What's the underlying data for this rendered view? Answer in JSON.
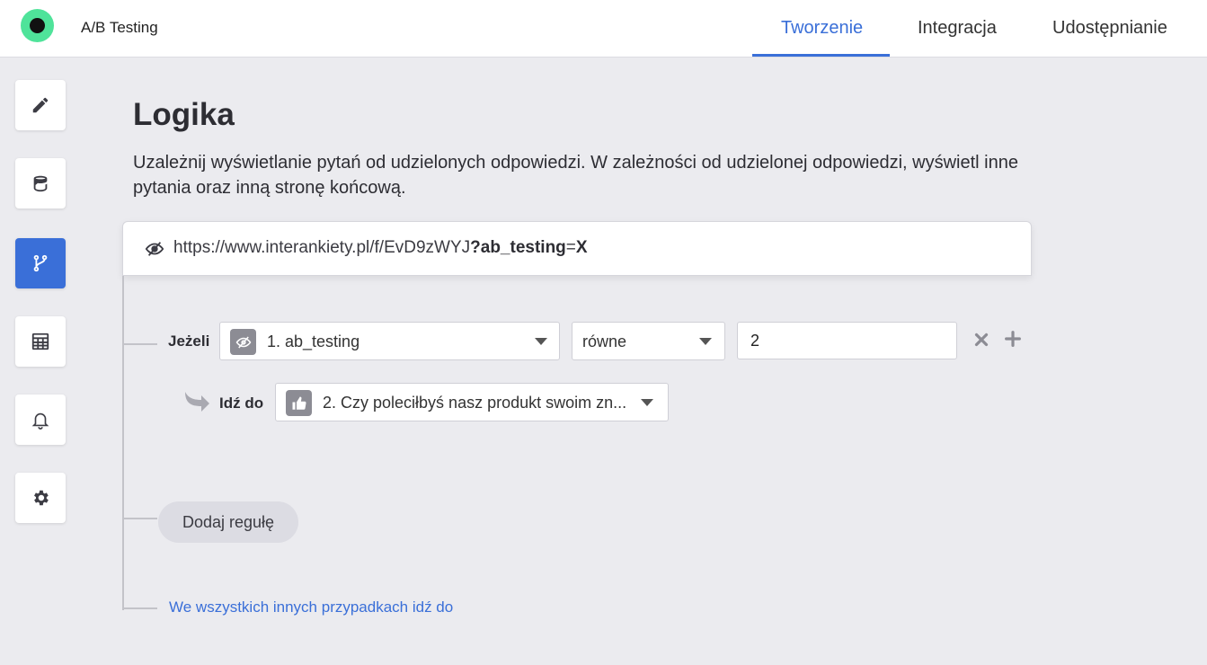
{
  "header": {
    "app_title": "A/B Testing",
    "tabs": [
      {
        "label": "Tworzenie",
        "active": true
      },
      {
        "label": "Integracja",
        "active": false
      },
      {
        "label": "Udostępnianie",
        "active": false
      }
    ]
  },
  "sidebar": {
    "items": [
      {
        "icon": "pencil-icon",
        "active": false
      },
      {
        "icon": "theme-bucket-icon",
        "active": false
      },
      {
        "icon": "logic-branch-icon",
        "active": true
      },
      {
        "icon": "calculator-icon",
        "active": false
      },
      {
        "icon": "bell-icon",
        "active": false
      },
      {
        "icon": "gear-icon",
        "active": false
      }
    ]
  },
  "main": {
    "title": "Logika",
    "description": "Uzależnij wyświetlanie pytań od udzielonych odpowiedzi. W zależności od udzielonej odpowiedzi, wyświetl inne pytania oraz inną stronę końcową.",
    "url": {
      "base": "https://www.interankiety.pl/f/EvD9zWYJ",
      "param": "?ab_testing",
      "eq": "=",
      "value": "X"
    },
    "rule": {
      "if_label": "Jeżeli",
      "question": "1. ab_testing",
      "operator": "równe",
      "value": "2",
      "goto_label": "Idź do",
      "goto_target": "2. Czy poleciłbyś nasz produkt swoim zn..."
    },
    "add_rule_label": "Dodaj regułę",
    "otherwise_label": "We wszystkich innych przypadkach idź do"
  },
  "colors": {
    "accent": "#3a6fd8",
    "logo": "#4fe39a",
    "background": "#ebebef"
  }
}
